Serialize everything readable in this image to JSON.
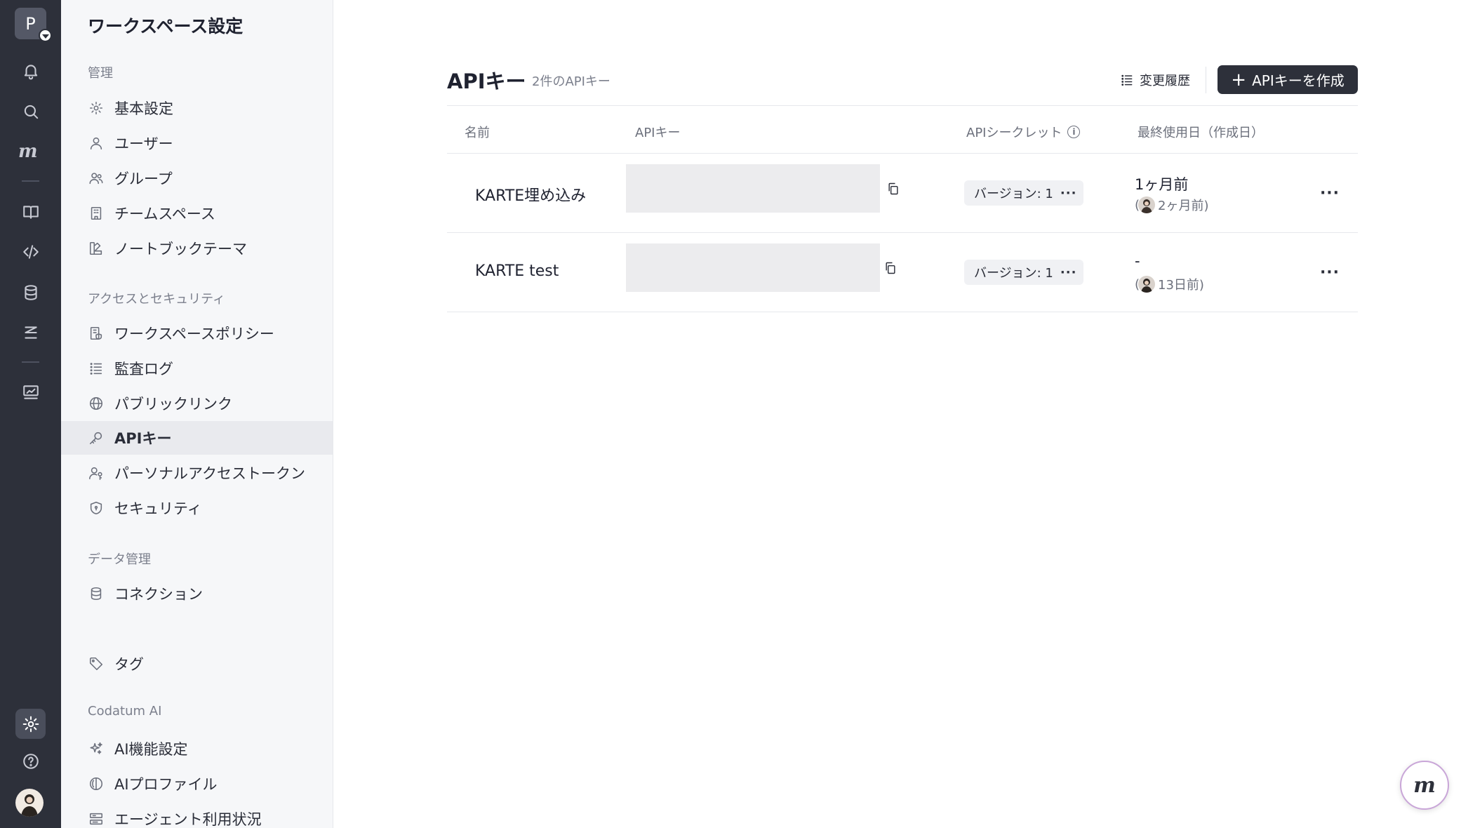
{
  "rail": {
    "workspace_initial": "P",
    "logo_text": "m",
    "items": [
      {
        "name": "bell-icon"
      },
      {
        "name": "search-icon"
      },
      {
        "name": "book-icon"
      },
      {
        "name": "code-icon"
      },
      {
        "name": "database-icon"
      },
      {
        "name": "flow-icon"
      },
      {
        "name": "monitor-chart-icon"
      },
      {
        "name": "gear-icon",
        "active": true
      },
      {
        "name": "help-icon"
      }
    ]
  },
  "sidebar": {
    "title": "ワークスペース設定",
    "sections": [
      {
        "label": "管理",
        "items": [
          {
            "label": "基本設定",
            "icon": "gear-icon"
          },
          {
            "label": "ユーザー",
            "icon": "user-icon"
          },
          {
            "label": "グループ",
            "icon": "users-icon"
          },
          {
            "label": "チームスペース",
            "icon": "building-icon"
          },
          {
            "label": "ノートブックテーマ",
            "icon": "palette-icon"
          }
        ]
      },
      {
        "label": "アクセスとセキュリティ",
        "items": [
          {
            "label": "ワークスペースポリシー",
            "icon": "policy-icon"
          },
          {
            "label": "監査ログ",
            "icon": "list-icon"
          },
          {
            "label": "パブリックリンク",
            "icon": "globe-icon"
          },
          {
            "label": "APIキー",
            "icon": "key-icon",
            "active": true
          },
          {
            "label": "パーソナルアクセストークン",
            "icon": "user-key-icon"
          },
          {
            "label": "セキュリティ",
            "icon": "shield-icon"
          }
        ]
      },
      {
        "label": "データ管理",
        "items": [
          {
            "label": "コネクション",
            "icon": "database-icon"
          }
        ]
      },
      {
        "label": "",
        "items": [
          {
            "label": "タグ",
            "icon": "tag-icon"
          }
        ]
      },
      {
        "label": "Codatum AI",
        "items": [
          {
            "label": "AI機能設定",
            "icon": "sparkle-icon"
          },
          {
            "label": "AIプロファイル",
            "icon": "brain-icon"
          },
          {
            "label": "エージェント利用状況",
            "icon": "usage-icon"
          }
        ]
      }
    ]
  },
  "main": {
    "title": "APIキー",
    "count": "2件のAPIキー",
    "history_label": "変更履歴",
    "create_label": "APIキーを作成",
    "columns": {
      "name": "名前",
      "api_key": "APIキー",
      "secret": "APIシークレット",
      "last_used": "最終使用日（作成日）"
    },
    "rows": [
      {
        "name": "KARTE埋め込み",
        "version": "バージョン: 1",
        "last_used": "1ヶ月前",
        "created": "2ヶ月前)"
      },
      {
        "name": "KARTE test",
        "version": "バージョン: 1",
        "last_used": "-",
        "created": "13日前)"
      }
    ]
  },
  "colors": {
    "rail_bg": "#2d303a",
    "sidebar_bg": "#f6f7f9",
    "primary_button": "#2d303a",
    "active_item_bg": "#e9eaee"
  }
}
